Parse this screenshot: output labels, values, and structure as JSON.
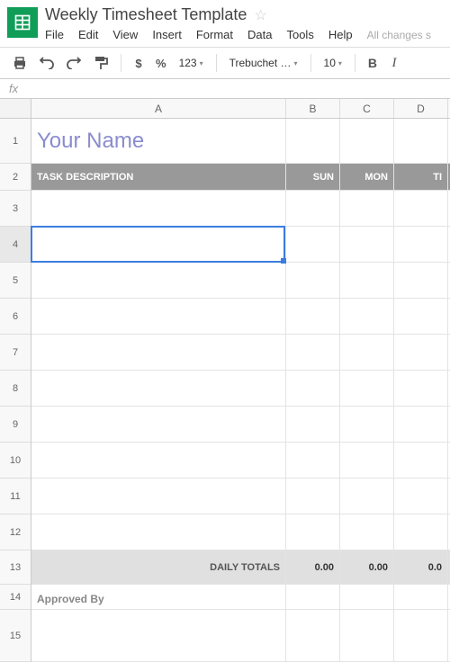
{
  "doc": {
    "title": "Weekly Timesheet Template",
    "save_status": "All changes s"
  },
  "menu": {
    "file": "File",
    "edit": "Edit",
    "view": "View",
    "insert": "Insert",
    "format": "Format",
    "data": "Data",
    "tools": "Tools",
    "help": "Help"
  },
  "toolbar": {
    "dollar": "$",
    "percent": "%",
    "numfmt": "123",
    "font": "Trebuchet …",
    "size": "10",
    "bold": "B",
    "italic": "I"
  },
  "fx": {
    "label": "fx"
  },
  "columns": {
    "A": "A",
    "B": "B",
    "C": "C",
    "D": "D"
  },
  "rows": {
    "r1": "1",
    "r2": "2",
    "r3": "3",
    "r4": "4",
    "r5": "5",
    "r6": "6",
    "r7": "7",
    "r8": "8",
    "r9": "9",
    "r10": "10",
    "r11": "11",
    "r12": "12",
    "r13": "13",
    "r14": "14",
    "r15": "15"
  },
  "sheet": {
    "name_title": "Your Name",
    "header": {
      "task": "TASK DESCRIPTION",
      "sun": "SUN",
      "mon": "MON",
      "tue": "TI"
    },
    "totals_label": "DAILY TOTALS",
    "totals": {
      "sun": "0.00",
      "mon": "0.00",
      "tue": "0.0"
    },
    "approved_label": "Approved By"
  },
  "selection": {
    "cell": "A4"
  }
}
